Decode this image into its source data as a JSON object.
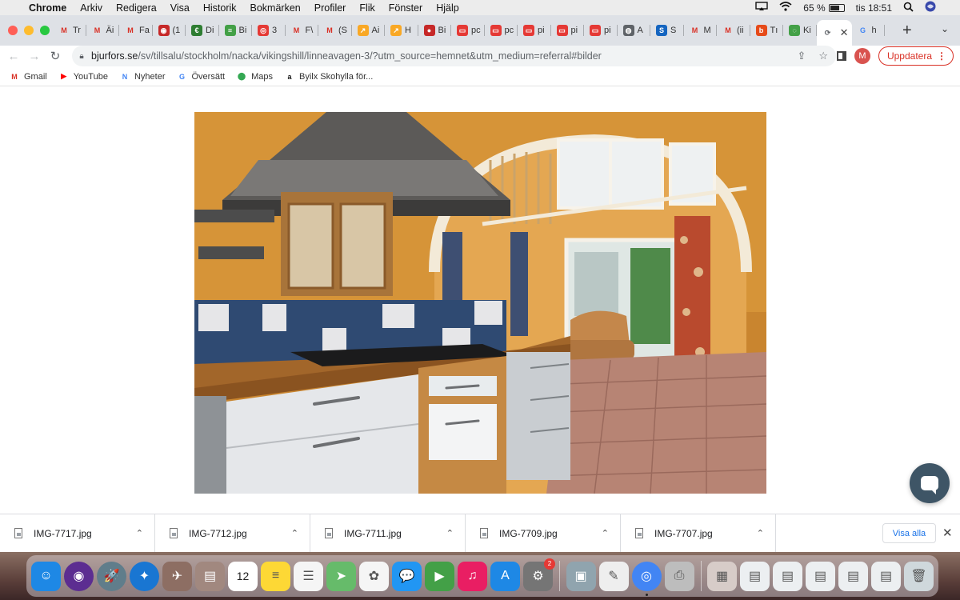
{
  "menubar": {
    "app": "Chrome",
    "items": [
      "Arkiv",
      "Redigera",
      "Visa",
      "Historik",
      "Bokmärken",
      "Profiler",
      "Flik",
      "Fönster",
      "Hjälp"
    ],
    "battery": "65 %",
    "clock": "tis 18:51"
  },
  "tabs": [
    {
      "label": "Tr",
      "icon": "gmail-icon",
      "color": "#d93025",
      "glyph": "M"
    },
    {
      "label": "Äi",
      "icon": "gmail-icon",
      "color": "#d93025",
      "glyph": "M"
    },
    {
      "label": "Fa",
      "icon": "gmail-icon",
      "color": "#d93025",
      "glyph": "M"
    },
    {
      "label": "(1",
      "icon": "red-circle-icon",
      "color": "#c62828",
      "glyph": "◉"
    },
    {
      "label": "Di",
      "icon": "green-circle-icon",
      "color": "#2e7d32",
      "glyph": "€"
    },
    {
      "label": "Bi",
      "icon": "green-square-icon",
      "color": "#43a047",
      "glyph": "≡"
    },
    {
      "label": "3",
      "icon": "target-icon",
      "color": "#e53935",
      "glyph": "◎"
    },
    {
      "label": "F\\",
      "icon": "gmail-icon",
      "color": "#d93025",
      "glyph": "M"
    },
    {
      "label": "(S",
      "icon": "gmail-icon",
      "color": "#d93025",
      "glyph": "M"
    },
    {
      "label": "Ai",
      "icon": "yellow-arrow-icon",
      "color": "#f9a825",
      "glyph": "↗"
    },
    {
      "label": "H",
      "icon": "yellow-arrow-icon",
      "color": "#f9a825",
      "glyph": "↗"
    },
    {
      "label": "Bi",
      "icon": "red-round-icon",
      "color": "#c62828",
      "glyph": "●"
    },
    {
      "label": "pc",
      "icon": "red-logo-icon",
      "color": "#e53935",
      "glyph": "▭"
    },
    {
      "label": "pc",
      "icon": "red-logo-icon",
      "color": "#e53935",
      "glyph": "▭"
    },
    {
      "label": "pi",
      "icon": "red-logo-icon",
      "color": "#e53935",
      "glyph": "▭"
    },
    {
      "label": "pi",
      "icon": "red-logo-icon",
      "color": "#e53935",
      "glyph": "▭"
    },
    {
      "label": "pi",
      "icon": "red-logo-icon",
      "color": "#e53935",
      "glyph": "▭"
    },
    {
      "label": "A",
      "icon": "globe-icon",
      "color": "#5f6368",
      "glyph": "◍"
    },
    {
      "label": "S",
      "icon": "blue-s-icon",
      "color": "#1565c0",
      "glyph": "S"
    },
    {
      "label": "M",
      "icon": "gmail-icon",
      "color": "#d93025",
      "glyph": "M"
    },
    {
      "label": "(ii",
      "icon": "gmail-icon",
      "color": "#d93025",
      "glyph": "M"
    },
    {
      "label": "Tı",
      "icon": "orange-b-icon",
      "color": "#e64a19",
      "glyph": "b"
    },
    {
      "label": "Ki",
      "icon": "green-circle-icon",
      "color": "#43a047",
      "glyph": "◌"
    },
    {
      "label": "",
      "icon": "loading-icon",
      "color": "#5f6368",
      "glyph": "⟳",
      "active": true
    },
    {
      "label": "h",
      "icon": "google-icon",
      "color": "#4285f4",
      "glyph": "G"
    }
  ],
  "toolbar": {
    "url_host": "bjurfors.se",
    "url_path": "/sv/tillsalu/stockholm/nacka/vikingshill/linneavagen-3/?utm_source=hemnet&utm_medium=referral#bilder",
    "profile_initial": "M",
    "update_label": "Uppdatera"
  },
  "bookmarks": [
    {
      "label": "Gmail",
      "icon": "gmail-icon",
      "color": "#d93025",
      "glyph": "M"
    },
    {
      "label": "YouTube",
      "icon": "youtube-icon",
      "color": "#ff0000",
      "glyph": "▶"
    },
    {
      "label": "Nyheter",
      "icon": "news-icon",
      "color": "#4285f4",
      "glyph": "N"
    },
    {
      "label": "Översätt",
      "icon": "translate-icon",
      "color": "#4285f4",
      "glyph": "G"
    },
    {
      "label": "Maps",
      "icon": "maps-icon",
      "color": "#34a853",
      "glyph": "⬤"
    },
    {
      "label": "Byilx Skohylla för...",
      "icon": "amazon-icon",
      "color": "#111111",
      "glyph": "a"
    }
  ],
  "downloads": [
    {
      "name": "IMG-7717.jpg"
    },
    {
      "name": "IMG-7712.jpg"
    },
    {
      "name": "IMG-7711.jpg"
    },
    {
      "name": "IMG-7709.jpg"
    },
    {
      "name": "IMG-7707.jpg"
    }
  ],
  "downloads_bar": {
    "show_all": "Visa alla"
  },
  "dock": [
    {
      "name": "finder-icon",
      "color": "#1e88e5",
      "glyph": "☺",
      "round": false
    },
    {
      "name": "siri-icon",
      "color": "#5c2d91",
      "glyph": "◉",
      "round": true
    },
    {
      "name": "launchpad-icon",
      "color": "#607d8b",
      "glyph": "🚀",
      "round": true
    },
    {
      "name": "safari-icon",
      "color": "#1976d2",
      "glyph": "✦",
      "round": true
    },
    {
      "name": "photo-slideshow-icon",
      "color": "#8d6e63",
      "glyph": "✈",
      "round": false
    },
    {
      "name": "contacts-icon",
      "color": "#a1887f",
      "glyph": "▤",
      "round": false
    },
    {
      "name": "calendar-icon",
      "color": "#ffffff",
      "glyph": "12",
      "round": false,
      "calendar": true
    },
    {
      "name": "notes-icon",
      "color": "#fdd835",
      "glyph": "≡",
      "round": false
    },
    {
      "name": "reminders-icon",
      "color": "#f5f5f5",
      "glyph": "☰",
      "round": false
    },
    {
      "name": "maps-app-icon",
      "color": "#66bb6a",
      "glyph": "➤",
      "round": false
    },
    {
      "name": "photos-icon",
      "color": "#f5f5f5",
      "glyph": "✿",
      "round": false
    },
    {
      "name": "messages-icon",
      "color": "#2196f3",
      "glyph": "💬",
      "round": false
    },
    {
      "name": "facetime-icon",
      "color": "#43a047",
      "glyph": "▶",
      "round": false
    },
    {
      "name": "music-icon",
      "color": "#e91e63",
      "glyph": "♫",
      "round": false
    },
    {
      "name": "app-store-icon",
      "color": "#1e88e5",
      "glyph": "A",
      "round": false
    },
    {
      "name": "system-preferences-icon",
      "color": "#757575",
      "glyph": "⚙",
      "round": false,
      "badge": "2"
    },
    {
      "sep": true
    },
    {
      "name": "preview-icon",
      "color": "#90a4ae",
      "glyph": "▣",
      "round": false
    },
    {
      "name": "textedit-icon",
      "color": "#eeeeee",
      "glyph": "✎",
      "round": false
    },
    {
      "name": "chrome-icon",
      "color": "#4285f4",
      "glyph": "◎",
      "round": true,
      "running": true
    },
    {
      "name": "printer-icon",
      "color": "#bdbdbd",
      "glyph": "⎙",
      "round": false
    },
    {
      "sep": true
    },
    {
      "name": "recent-document-1-icon",
      "color": "#d7ccc8",
      "glyph": "▦",
      "round": false
    },
    {
      "name": "recent-document-2-icon",
      "color": "#eceff1",
      "glyph": "▤",
      "round": false
    },
    {
      "name": "recent-document-3-icon",
      "color": "#eceff1",
      "glyph": "▤",
      "round": false
    },
    {
      "name": "recent-document-4-icon",
      "color": "#eceff1",
      "glyph": "▤",
      "round": false
    },
    {
      "name": "recent-document-5-icon",
      "color": "#eceff1",
      "glyph": "▤",
      "round": false
    },
    {
      "name": "recent-document-6-icon",
      "color": "#eceff1",
      "glyph": "▤",
      "round": false
    },
    {
      "name": "trash-icon",
      "color": "#cfd8dc",
      "glyph": "🗑",
      "round": false
    }
  ]
}
